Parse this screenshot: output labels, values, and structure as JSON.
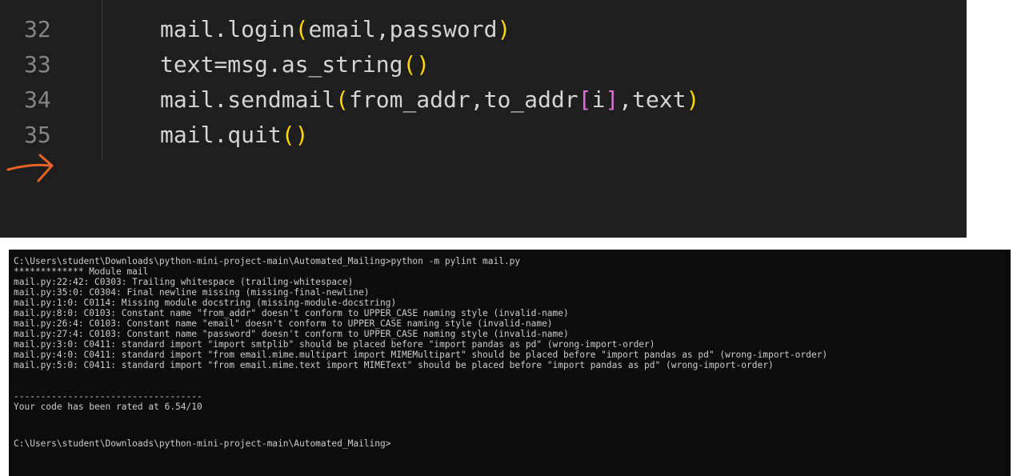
{
  "editor": {
    "lines": [
      {
        "num": "32",
        "pre": "mail.login",
        "open": "(",
        "args": "email,password",
        "close": ")",
        "post": ""
      },
      {
        "num": "33",
        "pre": "text=msg.as_string",
        "open": "(",
        "args": "",
        "close": ")",
        "post": ""
      },
      {
        "num": "34",
        "pre": "mail.sendmail",
        "open": "(",
        "args_a": "from_addr,to_addr",
        "sub_open": "[",
        "sub": "i",
        "sub_close": "]",
        "args_b": ",text",
        "close": ")"
      },
      {
        "num": "35",
        "pre": "mail.quit",
        "open": "(",
        "args": "",
        "close": ")",
        "post": ""
      }
    ],
    "annotation_icon": "hand-drawn-arrow-icon",
    "annotation_color": "#e8622a"
  },
  "terminal": {
    "command_line": "C:\\Users\\student\\Downloads\\python-mini-project-main\\Automated_Mailing>python -m pylint mail.py",
    "module_header": "************* Module mail",
    "messages": [
      "mail.py:22:42: C0303: Trailing whitespace (trailing-whitespace)",
      "mail.py:35:0: C0304: Final newline missing (missing-final-newline)",
      "mail.py:1:0: C0114: Missing module docstring (missing-module-docstring)",
      "mail.py:8:0: C0103: Constant name \"from_addr\" doesn't conform to UPPER_CASE naming style (invalid-name)",
      "mail.py:26:4: C0103: Constant name \"email\" doesn't conform to UPPER_CASE naming style (invalid-name)",
      "mail.py:27:4: C0103: Constant name \"password\" doesn't conform to UPPER_CASE naming style (invalid-name)",
      "mail.py:3:0: C0411: standard import \"import smtplib\" should be placed before \"import pandas as pd\" (wrong-import-order)",
      "mail.py:4:0: C0411: standard import \"from email.mime.multipart import MIMEMultipart\" should be placed before \"import pandas as pd\" (wrong-import-order)",
      "mail.py:5:0: C0411: standard import \"from email.mime.text import MIMEText\" should be placed before \"import pandas as pd\" (wrong-import-order)"
    ],
    "separator": "-----------------------------------",
    "rating": "Your code has been rated at 6.54/10",
    "prompt": "C:\\Users\\student\\Downloads\\python-mini-project-main\\Automated_Mailing>"
  }
}
